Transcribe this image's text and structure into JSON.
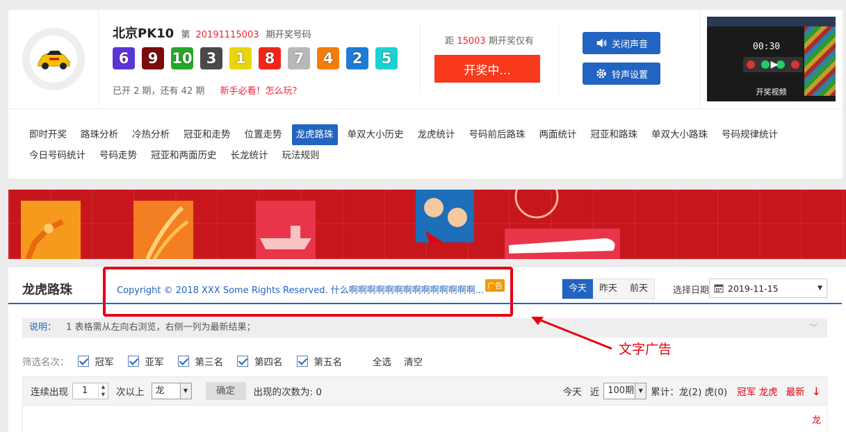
{
  "header": {
    "game_name": "北京PK10",
    "issue_prefix": "第",
    "issue_number": "20191115003",
    "issue_suffix": "期开奖号码",
    "balls": [
      {
        "num": "6",
        "color": "#5b34d6"
      },
      {
        "num": "9",
        "color": "#7a0c0c"
      },
      {
        "num": "10",
        "color": "#27a82a"
      },
      {
        "num": "3",
        "color": "#4a4a4a"
      },
      {
        "num": "1",
        "color": "#e8d60c"
      },
      {
        "num": "8",
        "color": "#f02518"
      },
      {
        "num": "7",
        "color": "#b8b8b8"
      },
      {
        "num": "4",
        "color": "#f27c0c"
      },
      {
        "num": "2",
        "color": "#1c7cd6"
      },
      {
        "num": "5",
        "color": "#19d3d3"
      }
    ],
    "status_text": "已开 2 期，还有 42 期",
    "help_link": "新手必看！怎么玩？",
    "countdown_prefix": "距",
    "countdown_issue": "15003",
    "countdown_suffix": "期开奖仅有",
    "draw_button": "开奖中...",
    "mute_button": "关闭声音",
    "ringtone_button": "铃声设置",
    "video_timer": "00:30",
    "video_label": "开奖视频"
  },
  "nav": {
    "row1": [
      "即时开奖",
      "路珠分析",
      "冷热分析",
      "冠亚和走势",
      "位置走势",
      "龙虎路珠",
      "单双大小历史",
      "龙虎统计",
      "号码前后路珠",
      "两面统计",
      "冠亚和路珠",
      "单双大小路珠",
      "号码规律统计"
    ],
    "row2": [
      "今日号码统计",
      "号码走势",
      "冠亚和两面历史",
      "长龙统计",
      "玩法规则"
    ],
    "active": "龙虎路珠"
  },
  "panel": {
    "title": "龙虎路珠",
    "ad_text": "Copyright © 2018 XXX Some Rights Reserved. 什么啊啊啊啊啊啊啊啊啊啊啊啊啊啊...",
    "ad_tag": "广告",
    "day_tabs": [
      "今天",
      "昨天",
      "前天"
    ],
    "date_label": "选择日期",
    "date_value": "2019-11-15",
    "note_label": "说明：",
    "note_text": "1 表格需从左向右浏览，右侧一列为最新结果；",
    "filter_label": "筛选名次：",
    "filter_options": [
      "冠军",
      "亚军",
      "第三名",
      "第四名",
      "第五名"
    ],
    "select_all": "全选",
    "clear": "清空",
    "toolbar": {
      "consecutive": "连续出现",
      "count_value": "1",
      "times_above": "次以上",
      "type_value": "龙",
      "confirm": "确定",
      "occurrences": "出现的次数为: 0",
      "today": "今天",
      "recent": "近",
      "period_value": "100期",
      "total": "累计：龙(2)  虎(0)",
      "champion_dragon": "冠军 龙虎",
      "newest": "最新",
      "arrow": "↓"
    },
    "first_cell": "龙"
  },
  "annotation": {
    "label": "文字广告"
  }
}
